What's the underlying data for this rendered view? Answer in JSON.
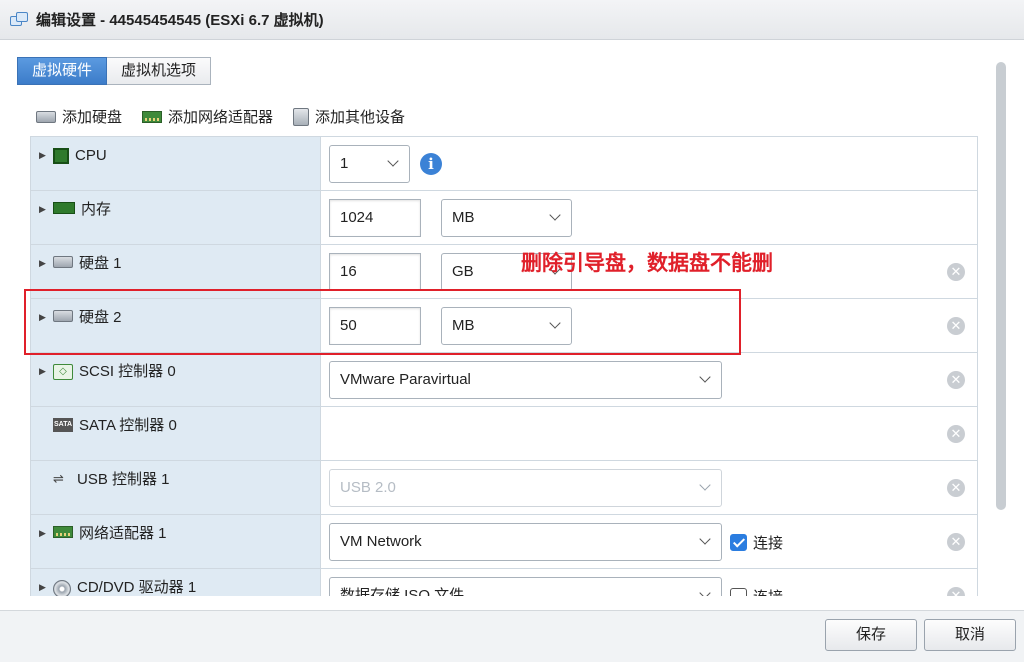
{
  "window": {
    "title": "编辑设置 - 44545454545 (ESXi 6.7 虚拟机)"
  },
  "tabs": [
    {
      "label": "虚拟硬件",
      "active": true
    },
    {
      "label": "虚拟机选项",
      "active": false
    }
  ],
  "toolbar": {
    "add_disk": "添加硬盘",
    "add_nic": "添加网络适配器",
    "add_other": "添加其他设备"
  },
  "rows": {
    "cpu": {
      "label": "CPU",
      "value": "1",
      "icon": "cpu-icon"
    },
    "memory": {
      "label": "内存",
      "value": "1024",
      "unit": "MB",
      "icon": "memory-icon"
    },
    "disk1": {
      "label": "硬盘 1",
      "value": "16",
      "unit": "GB",
      "icon": "disk-icon"
    },
    "disk2": {
      "label": "硬盘 2",
      "value": "50",
      "unit": "MB",
      "icon": "disk-icon"
    },
    "scsi": {
      "label": "SCSI 控制器 0",
      "value": "VMware Paravirtual",
      "icon": "scsi-icon"
    },
    "sata": {
      "label": "SATA 控制器 0",
      "icon": "sata-icon",
      "icon_text": "SATA"
    },
    "usb": {
      "label": "USB 控制器 1",
      "value": "USB 2.0",
      "icon": "usb-icon"
    },
    "nic": {
      "label": "网络适配器 1",
      "value": "VM Network",
      "connect": "连接",
      "connected": true,
      "icon": "nic-icon"
    },
    "cd": {
      "label": "CD/DVD 驱动器 1",
      "value": "数据存储 ISO 文件",
      "connect": "连接",
      "connected": false,
      "icon": "cd-icon"
    }
  },
  "annotation": {
    "text": "删除引导盘，数据盘不能删",
    "color": "#e0202a"
  },
  "footer": {
    "save": "保存",
    "cancel": "取消"
  },
  "colors": {
    "accent": "#3c7cc9",
    "label_bg": "#dfeaf3"
  }
}
